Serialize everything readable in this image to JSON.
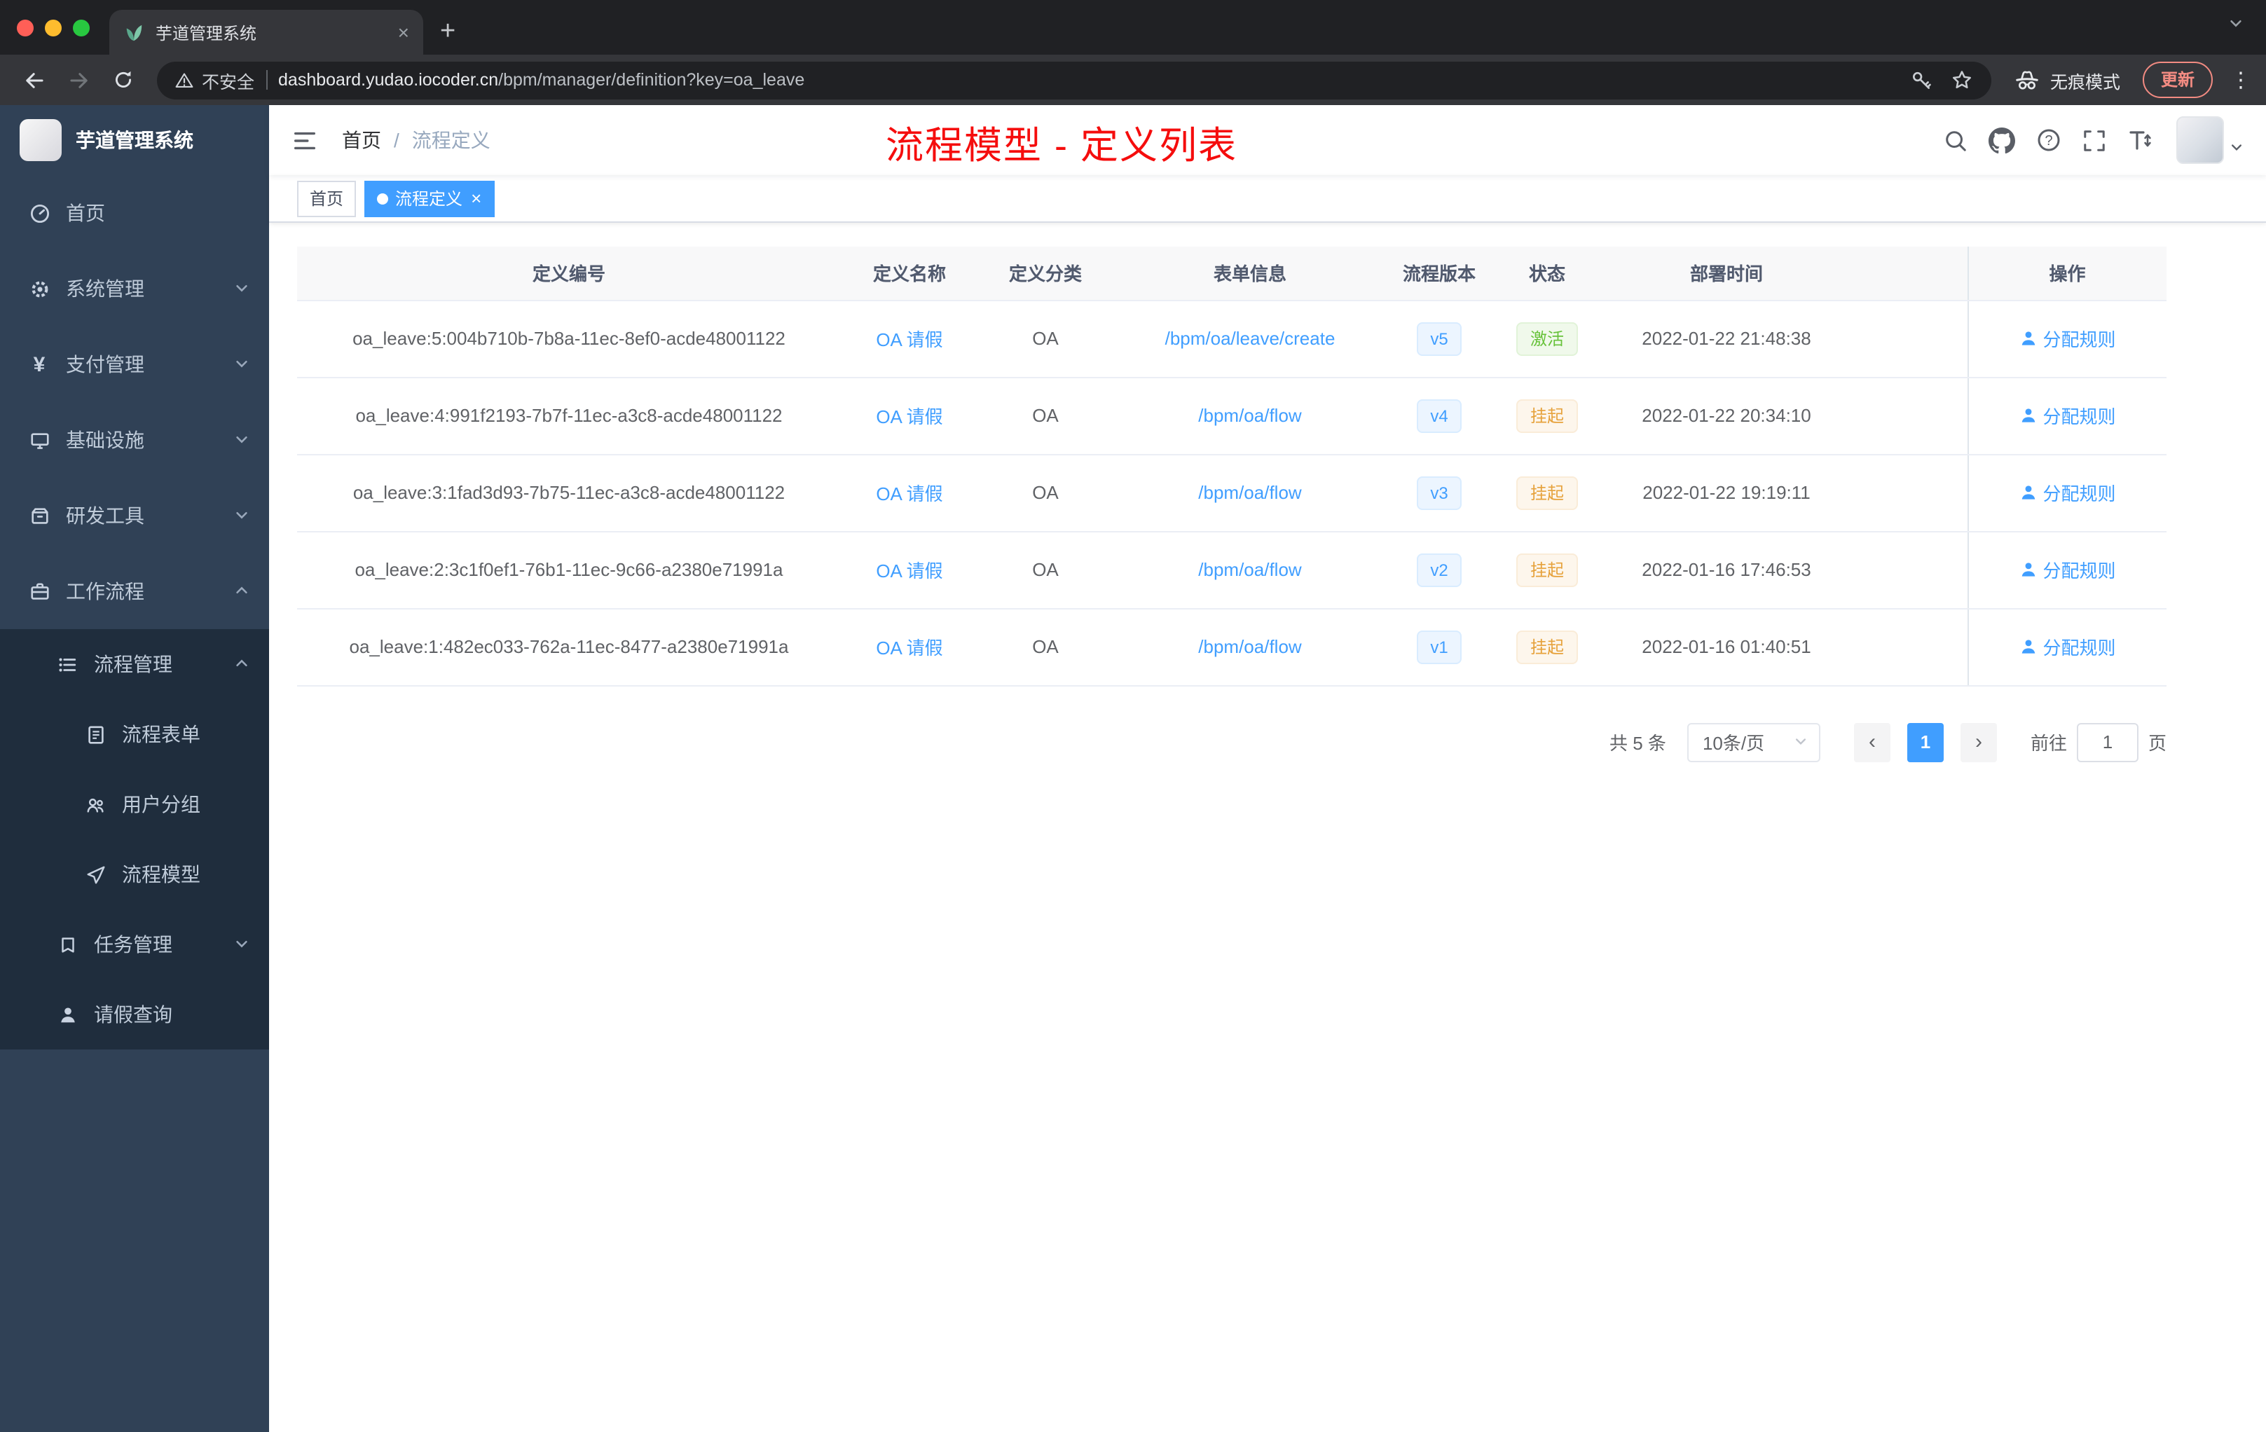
{
  "browser": {
    "tab_title": "芋道管理系统",
    "security_label": "不安全",
    "url_domain": "dashboard.yudao.iocoder.cn",
    "url_path": "/bpm/manager/definition?key=oa_leave",
    "incognito_label": "无痕模式",
    "update_label": "更新"
  },
  "sidebar": {
    "app_title": "芋道管理系统",
    "menu": [
      {
        "label": "首页",
        "icon": "dashboard-icon"
      },
      {
        "label": "系统管理",
        "icon": "gear-icon"
      },
      {
        "label": "支付管理",
        "icon": "yen-icon"
      },
      {
        "label": "基础设施",
        "icon": "monitor-icon"
      },
      {
        "label": "研发工具",
        "icon": "toolbox-icon"
      },
      {
        "label": "工作流程",
        "icon": "briefcase-icon"
      },
      {
        "label": "流程管理",
        "icon": "list-icon"
      },
      {
        "label": "流程表单",
        "icon": "document-icon"
      },
      {
        "label": "用户分组",
        "icon": "user-group-icon"
      },
      {
        "label": "流程模型",
        "icon": "paper-plane-icon"
      },
      {
        "label": "任务管理",
        "icon": "flag-icon"
      },
      {
        "label": "请假查询",
        "icon": "person-icon"
      }
    ]
  },
  "header": {
    "breadcrumb": {
      "home": "首页",
      "separator": "/",
      "current": "流程定义"
    },
    "annotation": "流程模型 - 定义列表"
  },
  "tags": {
    "home": "首页",
    "current": "流程定义",
    "close": "×"
  },
  "table": {
    "columns": {
      "id": "定义编号",
      "name": "定义名称",
      "category": "定义分类",
      "form": "表单信息",
      "version": "流程版本",
      "status": "状态",
      "time": "部署时间",
      "action": "操作"
    },
    "rows": [
      {
        "id": "oa_leave:5:004b710b-7b8a-11ec-8ef0-acde48001122",
        "name": "OA 请假",
        "category": "OA",
        "form": "/bpm/oa/leave/create",
        "version": "v5",
        "status": "激活",
        "status_type": "success",
        "time": "2022-01-22 21:48:38",
        "action": "分配规则"
      },
      {
        "id": "oa_leave:4:991f2193-7b7f-11ec-a3c8-acde48001122",
        "name": "OA 请假",
        "category": "OA",
        "form": "/bpm/oa/flow",
        "version": "v4",
        "status": "挂起",
        "status_type": "warning",
        "time": "2022-01-22 20:34:10",
        "action": "分配规则"
      },
      {
        "id": "oa_leave:3:1fad3d93-7b75-11ec-a3c8-acde48001122",
        "name": "OA 请假",
        "category": "OA",
        "form": "/bpm/oa/flow",
        "version": "v3",
        "status": "挂起",
        "status_type": "warning",
        "time": "2022-01-22 19:19:11",
        "action": "分配规则"
      },
      {
        "id": "oa_leave:2:3c1f0ef1-76b1-11ec-9c66-a2380e71991a",
        "name": "OA 请假",
        "category": "OA",
        "form": "/bpm/oa/flow",
        "version": "v2",
        "status": "挂起",
        "status_type": "warning",
        "time": "2022-01-16 17:46:53",
        "action": "分配规则"
      },
      {
        "id": "oa_leave:1:482ec033-762a-11ec-8477-a2380e71991a",
        "name": "OA 请假",
        "category": "OA",
        "form": "/bpm/oa/flow",
        "version": "v1",
        "status": "挂起",
        "status_type": "warning",
        "time": "2022-01-16 01:40:51",
        "action": "分配规则"
      }
    ]
  },
  "pagination": {
    "total": "共 5 条",
    "page_size": "10条/页",
    "prev": "‹",
    "page": "1",
    "next": "›",
    "goto_label": "前往",
    "goto_value": "1",
    "page_unit": "页"
  },
  "colors": {
    "accent": "#409eff",
    "success": "#67c23a",
    "warning": "#e6a23c",
    "annotation_red": "#f50d0d",
    "sidebar_bg": "#304156",
    "submenu_bg": "#1f2d3d"
  }
}
